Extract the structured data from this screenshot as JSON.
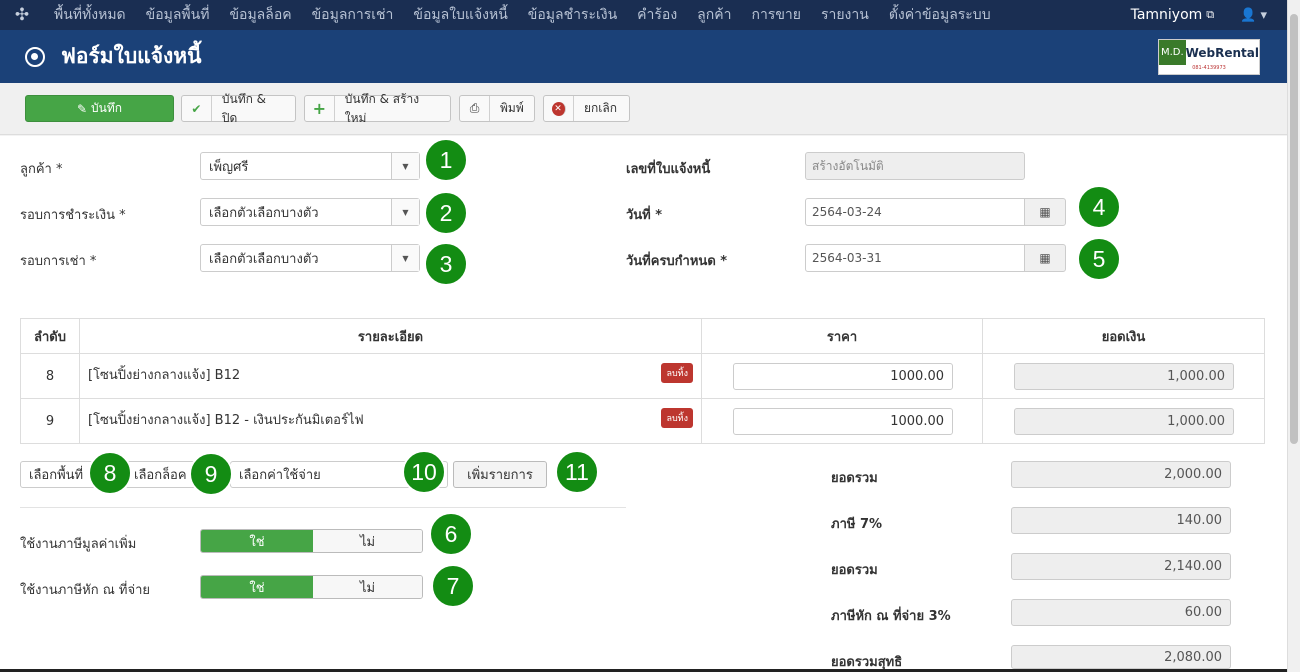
{
  "nav": {
    "items": [
      "พื้นที่ทั้งหมด",
      "ข้อมูลพื้นที่",
      "ข้อมูลล็อค",
      "ข้อมูลการเช่า",
      "ข้อมูลใบแจ้งหนี้",
      "ข้อมูลชำระเงิน",
      "คำร้อง",
      "ลูกค้า",
      "การขาย",
      "รายงาน",
      "ตั้งค่าข้อมูลระบบ"
    ],
    "user": "Tamniyom",
    "external_icon": "external-link-icon",
    "user_icon": "user-icon"
  },
  "header": {
    "title": "ฟอร์มใบแจ้งหนี้",
    "logo_left": "M.D.",
    "logo_right": "WebRental",
    "logo_sub": "081-4139973"
  },
  "toolbar": {
    "save": "บันทึก",
    "save_close": "บันทึก & ปิด",
    "save_new": "บันทึก & สร้างใหม่",
    "print": "พิมพ์",
    "cancel": "ยกเลิก"
  },
  "form": {
    "customer_label": "ลูกค้า *",
    "customer_value": "เพ็ญศรี",
    "payment_cycle_label": "รอบการชำระเงิน *",
    "payment_cycle_value": "เลือกตัวเลือกบางตัว",
    "rental_cycle_label": "รอบการเช่า *",
    "rental_cycle_value": "เลือกตัวเลือกบางตัว",
    "invoice_no_label": "เลขที่ใบแจ้งหนี้",
    "invoice_no_value": "สร้างอัตโนมัติ",
    "date_label": "วันที่ *",
    "date_value": "2564-03-24",
    "due_date_label": "วันที่ครบกำหนด *",
    "due_date_value": "2564-03-31"
  },
  "badges": [
    "1",
    "2",
    "3",
    "4",
    "5",
    "6",
    "7",
    "8",
    "9",
    "10",
    "11"
  ],
  "table": {
    "headers": [
      "ลำดับ",
      "รายละเอียด",
      "ราคา",
      "ยอดเงิน"
    ],
    "rows": [
      {
        "no": "8",
        "desc": "[โซนปิ้งย่างกลางแจ้ง] B12",
        "delete": "ลบทิ้ง",
        "price": "1000.00",
        "amount": "1,000.00"
      },
      {
        "no": "9",
        "desc": "[โซนปิ้งย่างกลางแจ้ง] B12 - เงินประกันมิเตอร์ไฟ",
        "delete": "ลบทิ้ง",
        "price": "1000.00",
        "amount": "1,000.00"
      }
    ]
  },
  "add_row": {
    "area": "เลือกพื้นที่",
    "lock": "เลือกล็อค",
    "expense": "เลือกค่าใช้จ่าย",
    "add_button": "เพิ่มรายการ"
  },
  "tax": {
    "vat_label": "ใช้งานภาษีมูลค่าเพิ่ม",
    "wht_label": "ใช้งานภาษีหัก ณ ที่จ่าย",
    "yes": "ใช่",
    "no": "ไม่"
  },
  "summary": [
    {
      "label": "ยอดรวม",
      "value": "2,000.00"
    },
    {
      "label": "ภาษี 7%",
      "value": "140.00"
    },
    {
      "label": "ยอดรวม",
      "value": "2,140.00"
    },
    {
      "label": "ภาษีหัก ณ ที่จ่าย 3%",
      "value": "60.00"
    },
    {
      "label": "ยอดรวมสุทธิ",
      "value": "2,080.00"
    }
  ],
  "colors": {
    "nav_bg": "#1a2e52",
    "header_bg": "#1b4178",
    "success": "#46a546",
    "danger": "#bd362f",
    "badge": "#138c13"
  }
}
